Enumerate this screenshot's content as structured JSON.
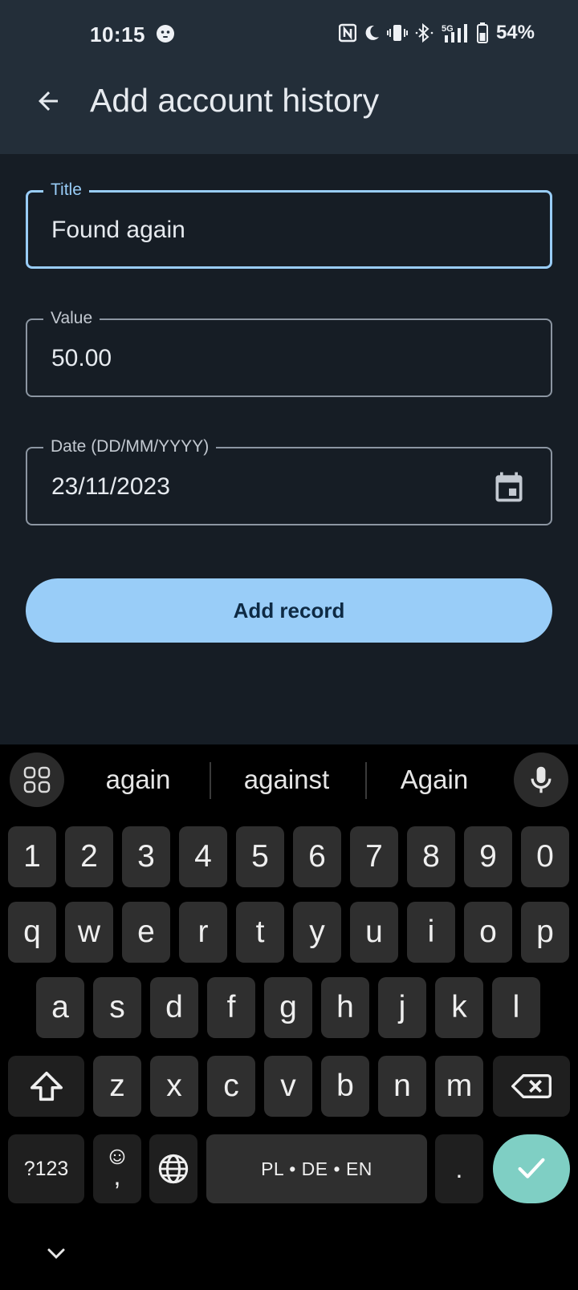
{
  "status_bar": {
    "time": "10:15",
    "battery_percent": "54%",
    "network": "5G",
    "icons": [
      "smiley-face-icon",
      "nfc-icon",
      "moon-icon",
      "vibrate-icon",
      "bluetooth-icon",
      "signal-icon",
      "battery-icon"
    ]
  },
  "app_bar": {
    "title": "Add account history",
    "back_icon": "arrow-back-icon"
  },
  "form": {
    "title": {
      "label": "Title",
      "value": "Found again"
    },
    "value": {
      "label": "Value",
      "value": "50.00"
    },
    "date": {
      "label": "Date (DD/MM/YYYY)",
      "value": "23/11/2023",
      "icon": "calendar-icon"
    },
    "submit_label": "Add record"
  },
  "keyboard": {
    "suggestions": [
      "again",
      "against",
      "Again"
    ],
    "row_numbers": [
      "1",
      "2",
      "3",
      "4",
      "5",
      "6",
      "7",
      "8",
      "9",
      "0"
    ],
    "row_top": [
      "q",
      "w",
      "e",
      "r",
      "t",
      "y",
      "u",
      "i",
      "o",
      "p"
    ],
    "row_middle": [
      "a",
      "s",
      "d",
      "f",
      "g",
      "h",
      "j",
      "k",
      "l"
    ],
    "row_bottom": [
      "z",
      "x",
      "c",
      "v",
      "b",
      "n",
      "m"
    ],
    "symbols_label": "?123",
    "comma_label": ",",
    "space_label": "PL • DE • EN",
    "period_label": ".",
    "colors": {
      "accent": "#99cdf8",
      "enter": "#7fcfc4",
      "key": "#2f2f2f"
    }
  }
}
